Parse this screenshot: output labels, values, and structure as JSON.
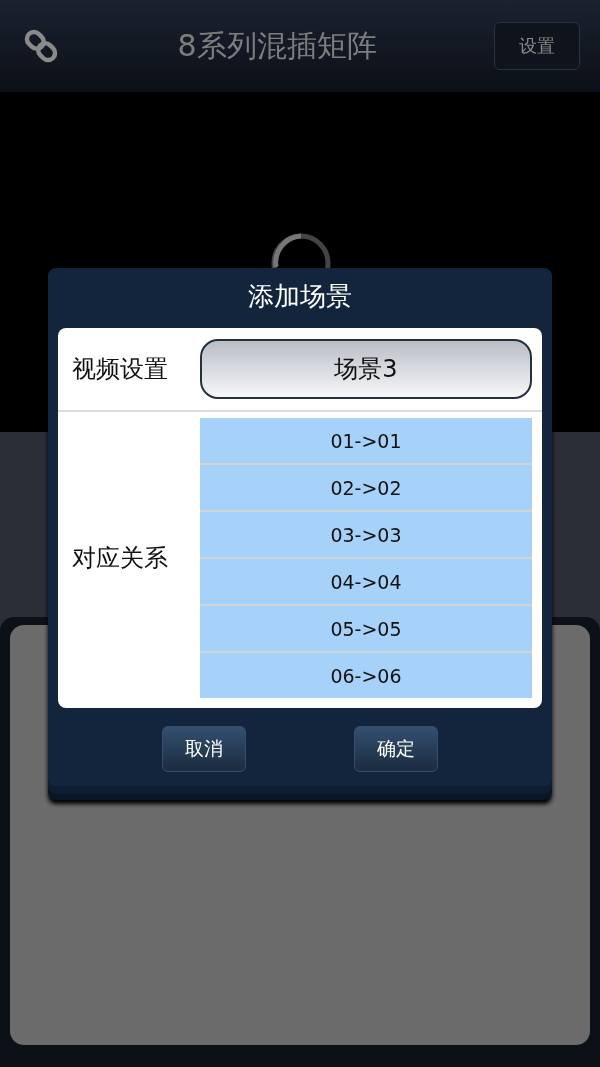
{
  "header": {
    "title": "8系列混插矩阵",
    "settings_button": "设置"
  },
  "dialog": {
    "title": "添加场景",
    "video_label": "视频设置",
    "scene_name": "场景3",
    "mapping_label": "对应关系",
    "mappings": [
      "01->01",
      "02->02",
      "03->03",
      "04->04",
      "05->05",
      "06->06"
    ],
    "buttons": [
      "取消",
      "确定"
    ]
  }
}
